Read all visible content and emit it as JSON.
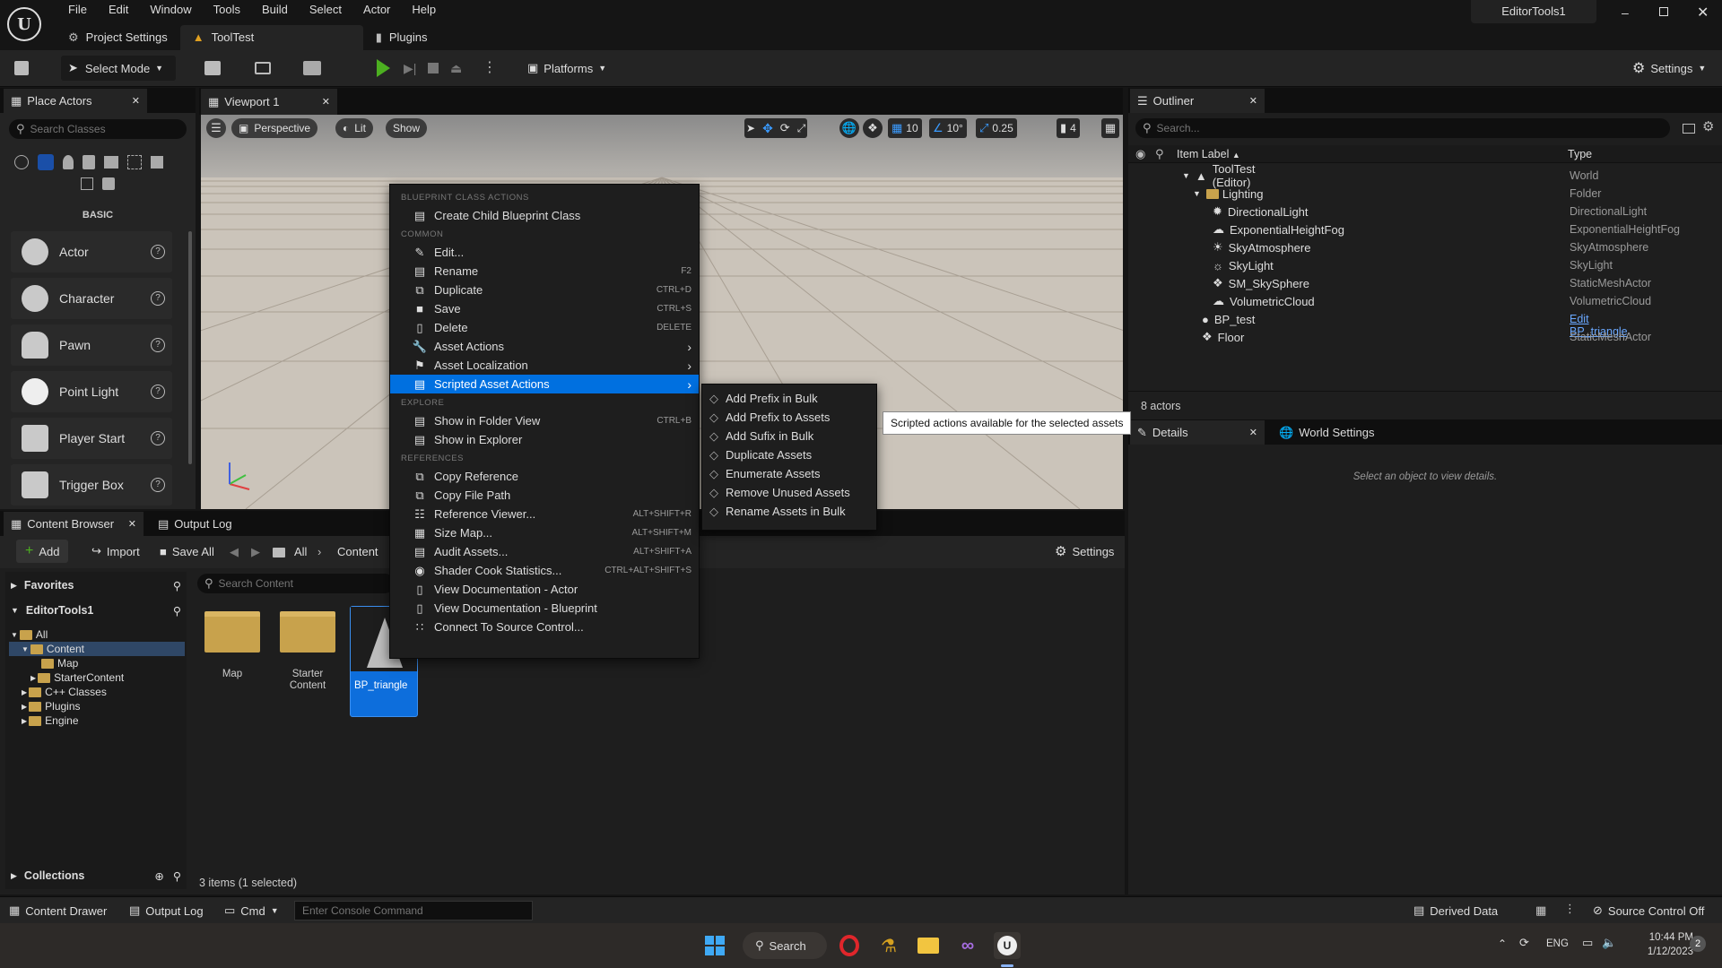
{
  "menu": [
    "File",
    "Edit",
    "Window",
    "Tools",
    "Build",
    "Select",
    "Actor",
    "Help"
  ],
  "window_title": "EditorTools1",
  "tabs": {
    "project_settings": "Project Settings",
    "tooltest": "ToolTest",
    "plugins": "Plugins"
  },
  "toolbar": {
    "select_mode": "Select Mode",
    "platforms": "Platforms",
    "settings": "Settings"
  },
  "place_actors": {
    "title": "Place Actors",
    "search_placeholder": "Search Classes",
    "category": "BASIC",
    "items": [
      "Actor",
      "Character",
      "Pawn",
      "Point Light",
      "Player Start",
      "Trigger Box"
    ]
  },
  "viewport": {
    "title": "Viewport 1",
    "perspective": "Perspective",
    "lit": "Lit",
    "show": "Show",
    "grid_snap": "10",
    "rot_snap": "10°",
    "scale_snap": "0.25",
    "cam_speed": "4"
  },
  "context_menu": {
    "sections": {
      "bp": "BLUEPRINT CLASS ACTIONS",
      "common": "COMMON",
      "explore": "EXPLORE",
      "references": "REFERENCES"
    },
    "bp_items": [
      {
        "label": "Create Child Blueprint Class",
        "shortcut": ""
      }
    ],
    "common_items": [
      {
        "label": "Edit...",
        "shortcut": ""
      },
      {
        "label": "Rename",
        "shortcut": "F2"
      },
      {
        "label": "Duplicate",
        "shortcut": "CTRL+D"
      },
      {
        "label": "Save",
        "shortcut": "CTRL+S"
      },
      {
        "label": "Delete",
        "shortcut": "DELETE"
      },
      {
        "label": "Asset Actions",
        "shortcut": ""
      },
      {
        "label": "Asset Localization",
        "shortcut": ""
      },
      {
        "label": "Scripted Asset Actions",
        "shortcut": ""
      }
    ],
    "explore_items": [
      {
        "label": "Show in Folder View",
        "shortcut": "CTRL+B"
      },
      {
        "label": "Show in Explorer",
        "shortcut": ""
      }
    ],
    "reference_items": [
      {
        "label": "Copy Reference",
        "shortcut": ""
      },
      {
        "label": "Copy File Path",
        "shortcut": ""
      },
      {
        "label": "Reference Viewer...",
        "shortcut": "ALT+SHIFT+R"
      },
      {
        "label": "Size Map...",
        "shortcut": "ALT+SHIFT+M"
      },
      {
        "label": "Audit Assets...",
        "shortcut": "ALT+SHIFT+A"
      },
      {
        "label": "Shader Cook Statistics...",
        "shortcut": "CTRL+ALT+SHIFT+S"
      },
      {
        "label": "View Documentation - Actor",
        "shortcut": ""
      },
      {
        "label": "View Documentation - Blueprint",
        "shortcut": ""
      },
      {
        "label": "Connect To Source Control...",
        "shortcut": ""
      }
    ]
  },
  "submenu": [
    "Add Prefix in Bulk",
    "Add Prefix to Assets",
    "Add Sufix in Bulk",
    "Duplicate Assets",
    "Enumerate Assets",
    "Remove Unused Assets",
    "Rename Assets in Bulk"
  ],
  "tooltip": "Scripted actions available for the selected assets",
  "outliner": {
    "title": "Outliner",
    "search_placeholder": "Search...",
    "col_label": "Item Label",
    "col_type": "Type",
    "rows": [
      {
        "label": "ToolTest (Editor)",
        "type": "World"
      },
      {
        "label": "Lighting",
        "type": "Folder"
      },
      {
        "label": "DirectionalLight",
        "type": "DirectionalLight"
      },
      {
        "label": "ExponentialHeightFog",
        "type": "ExponentialHeightFog"
      },
      {
        "label": "SkyAtmosphere",
        "type": "SkyAtmosphere"
      },
      {
        "label": "SkyLight",
        "type": "SkyLight"
      },
      {
        "label": "SM_SkySphere",
        "type": "StaticMeshActor"
      },
      {
        "label": "VolumetricCloud",
        "type": "VolumetricCloud"
      },
      {
        "label": "BP_test",
        "type": "Edit BP_triangle"
      },
      {
        "label": "Floor",
        "type": "StaticMeshActor"
      }
    ],
    "count": "8 actors"
  },
  "details": {
    "title": "Details",
    "world_settings": "World Settings",
    "empty": "Select an object to view details."
  },
  "content_browser": {
    "title": "Content Browser",
    "output_log": "Output Log",
    "add": "Add",
    "import": "Import",
    "save_all": "Save All",
    "crumb_all": "All",
    "crumb_content": "Content",
    "settings": "Settings",
    "favorites": "Favorites",
    "project": "EditorTools1",
    "search_placeholder": "Search Content",
    "tree": [
      "All",
      "Content",
      "Map",
      "StarterContent",
      "C++ Classes",
      "Plugins",
      "Engine"
    ],
    "assets": [
      "Map",
      "Starter Content",
      "BP_triangle"
    ],
    "collections": "Collections",
    "status": "3 items (1 selected)"
  },
  "statusbar": {
    "content_drawer": "Content Drawer",
    "output_log": "Output Log",
    "cmd": "Cmd",
    "console_placeholder": "Enter Console Command",
    "derived_data": "Derived Data",
    "source_control": "Source Control Off"
  },
  "taskbar": {
    "search": "Search",
    "lang": "ENG",
    "time": "10:44 PM",
    "date": "1/12/2023",
    "badge": "2"
  }
}
